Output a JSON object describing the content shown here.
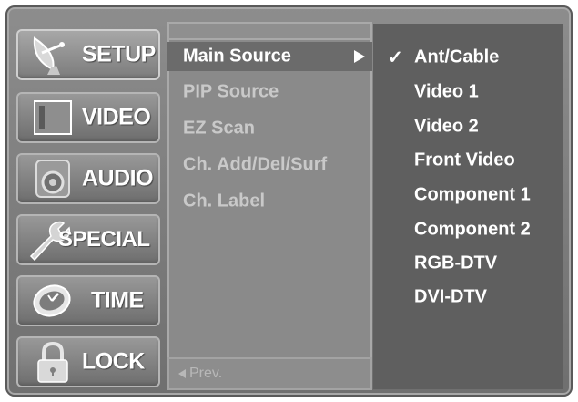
{
  "menu": {
    "categories": [
      {
        "label": "SETUP",
        "icon": "satellite-dish-icon",
        "selected": true
      },
      {
        "label": "VIDEO",
        "icon": "screen-icon",
        "selected": false
      },
      {
        "label": "AUDIO",
        "icon": "speaker-icon",
        "selected": false
      },
      {
        "label": "SPECIAL",
        "icon": "wrench-icon",
        "selected": false
      },
      {
        "label": "TIME",
        "icon": "clock-icon",
        "selected": false
      },
      {
        "label": "LOCK",
        "icon": "padlock-icon",
        "selected": false
      }
    ]
  },
  "submenu": {
    "items": [
      {
        "label": "Main Source",
        "active": true
      },
      {
        "label": "PIP Source",
        "active": false
      },
      {
        "label": "EZ Scan",
        "active": false
      },
      {
        "label": "Ch. Add/Del/Surf",
        "active": false
      },
      {
        "label": "Ch. Label",
        "active": false
      }
    ],
    "prev_label": "Prev."
  },
  "options": {
    "items": [
      {
        "label": "Ant/Cable",
        "checked": true
      },
      {
        "label": "Video 1",
        "checked": false
      },
      {
        "label": "Video 2",
        "checked": false
      },
      {
        "label": "Front Video",
        "checked": false
      },
      {
        "label": "Component 1",
        "checked": false
      },
      {
        "label": "Component 2",
        "checked": false
      },
      {
        "label": "RGB-DTV",
        "checked": false
      },
      {
        "label": "DVI-DTV",
        "checked": false
      }
    ],
    "check_glyph": "✓"
  }
}
